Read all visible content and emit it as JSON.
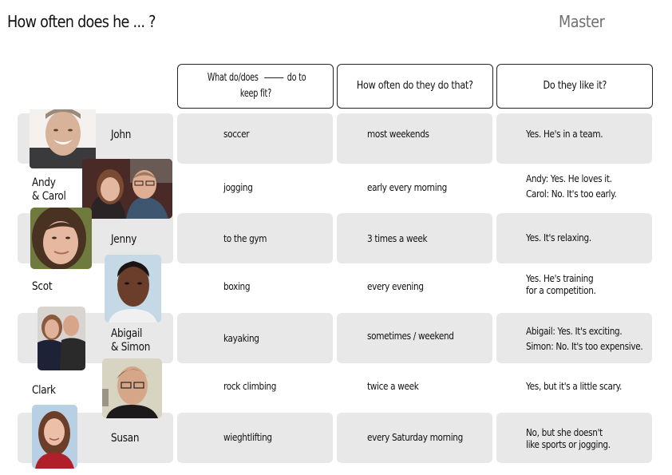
{
  "header": {
    "title": "How often does he ... ?",
    "badge": "Master"
  },
  "columns": {
    "col1_part1": "What do/does",
    "col1_part2": "do to",
    "col1_line2": "keep fit?",
    "col2": "How often do they do that?",
    "col3": "Do they like it?"
  },
  "rows": [
    {
      "name_line1": "John",
      "name_line2": "",
      "activity": "soccer",
      "frequency": "most weekends",
      "opinion_line1": "Yes. He's in a team.",
      "opinion_line2": ""
    },
    {
      "name_line1": "Andy",
      "name_line2": "& Carol",
      "activity": "jogging",
      "frequency": "early every morning",
      "opinion_line1": "Andy: Yes. He loves it.",
      "opinion_line2": "Carol: No. It's too early."
    },
    {
      "name_line1": "Jenny",
      "name_line2": "",
      "activity": "to the gym",
      "frequency": "3 times a week",
      "opinion_line1": "Yes. It's relaxing.",
      "opinion_line2": ""
    },
    {
      "name_line1": "Scot",
      "name_line2": "",
      "activity": "boxing",
      "frequency": "every evening",
      "opinion_line1": "Yes. He's training",
      "opinion_line2": "for a competition."
    },
    {
      "name_line1": "Abigail",
      "name_line2": "& Simon",
      "activity": "kayaking",
      "frequency": "sometimes / weekend",
      "opinion_line1": "Abigail: Yes. It's exciting.",
      "opinion_line2": "Simon: No. It's too expensive."
    },
    {
      "name_line1": "Clark",
      "name_line2": "",
      "activity": "rock climbing",
      "frequency": "twice a week",
      "opinion_line1": "Yes, but it's a little scary.",
      "opinion_line2": ""
    },
    {
      "name_line1": "Susan",
      "name_line2": "",
      "activity": "wieghtlifting",
      "frequency": "every Saturday morning",
      "opinion_line1": "No, but she doesn't",
      "opinion_line2": "like sports or jogging."
    }
  ],
  "colors": {
    "row_shade": "#e8e8e8",
    "badge_text": "#707070",
    "border": "#222222"
  }
}
